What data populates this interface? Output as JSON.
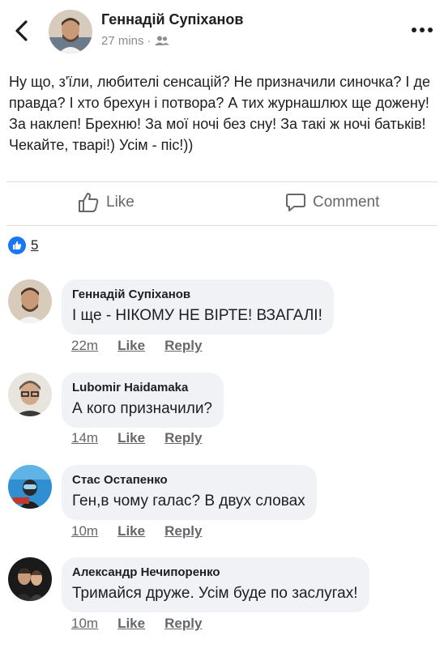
{
  "post": {
    "author": "Геннадій Супіханов",
    "time": "27 mins",
    "separator": "·",
    "text": "Ну що, з'їли, любителі сенсацій? Не призначили синочка? І де правда? І хто брехун і потвора? А тих журнашлюх ще дожену! За наклеп! Брехню! За мої ночі без сну! За такі ж ночі батьків! Чекайте, тварі!) Усім - піс!))"
  },
  "actions": {
    "like": "Like",
    "comment": "Comment"
  },
  "reactions": {
    "count": "5"
  },
  "comments": [
    {
      "name": "Геннадій Супіханов",
      "text": "І ще - НІКОМУ НЕ ВІРТЕ! ВЗАГАЛІ!",
      "time": "22m",
      "like": "Like",
      "reply": "Reply"
    },
    {
      "name": "Lubomir Haidamaka",
      "text": "А кого призначили?",
      "time": "14m",
      "like": "Like",
      "reply": "Reply"
    },
    {
      "name": "Стас Остапенко",
      "text": "Ген,в чому галас? В двух словах",
      "time": "10m",
      "like": "Like",
      "reply": "Reply"
    },
    {
      "name": "Александр Нечипоренко",
      "text": "Тримайся друже. Усім буде по заслугах!",
      "time": "10m",
      "like": "Like",
      "reply": "Reply"
    }
  ],
  "colors": {
    "accent": "#1877f2",
    "bubble": "#f0f2f5",
    "muted": "#65676b"
  },
  "icons": [
    "back-arrow-icon",
    "friends-icon",
    "more-icon",
    "thumbs-up-icon",
    "comment-icon",
    "like-reaction-icon"
  ]
}
